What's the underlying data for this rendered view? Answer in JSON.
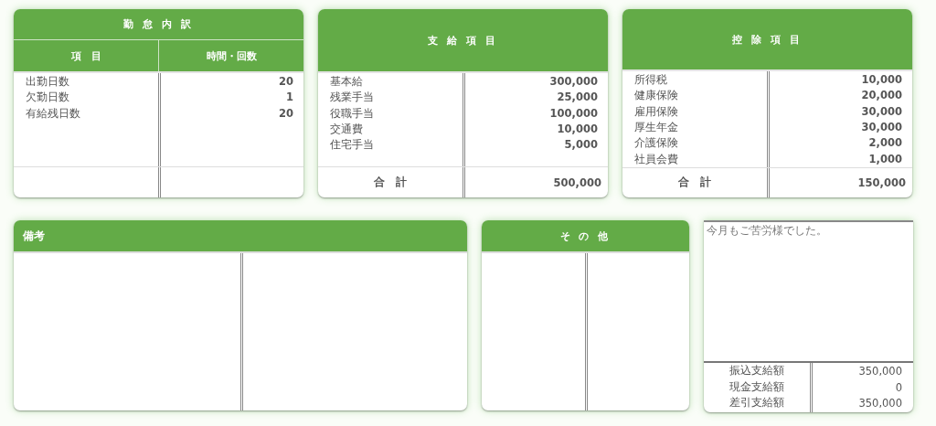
{
  "attendance": {
    "title": "勤 怠 内 訳",
    "columns": [
      "項　目",
      "時間・回数"
    ],
    "rows": [
      {
        "item": "出勤日数",
        "value": "20"
      },
      {
        "item": "欠勤日数",
        "value": "1"
      },
      {
        "item": "有給残日数",
        "value": "20"
      }
    ]
  },
  "payments": {
    "title": "支 給 項 目",
    "rows": [
      {
        "item": "基本給",
        "value": "300,000"
      },
      {
        "item": "残業手当",
        "value": "25,000"
      },
      {
        "item": "役職手当",
        "value": "100,000"
      },
      {
        "item": "交通費",
        "value": "10,000"
      },
      {
        "item": "住宅手当",
        "value": "5,000"
      }
    ],
    "total_label": "合　計",
    "total": "500,000"
  },
  "deductions": {
    "title": "控 除 項 目",
    "rows": [
      {
        "item": "所得税",
        "value": "10,000"
      },
      {
        "item": "健康保険",
        "value": "20,000"
      },
      {
        "item": "雇用保険",
        "value": "30,000"
      },
      {
        "item": "厚生年金",
        "value": "30,000"
      },
      {
        "item": "介護保険",
        "value": "2,000"
      },
      {
        "item": "社員会費",
        "value": "1,000"
      }
    ],
    "total_label": "合　計",
    "total": "150,000"
  },
  "remarks": {
    "title": "備考"
  },
  "other": {
    "title": "そ の 他"
  },
  "message": {
    "text": "今月もご苦労様でした。",
    "summary": [
      {
        "label": "振込支給額",
        "value": "350,000"
      },
      {
        "label": "現金支給額",
        "value": "0"
      },
      {
        "label": "差引支給額",
        "value": "350,000"
      }
    ]
  }
}
